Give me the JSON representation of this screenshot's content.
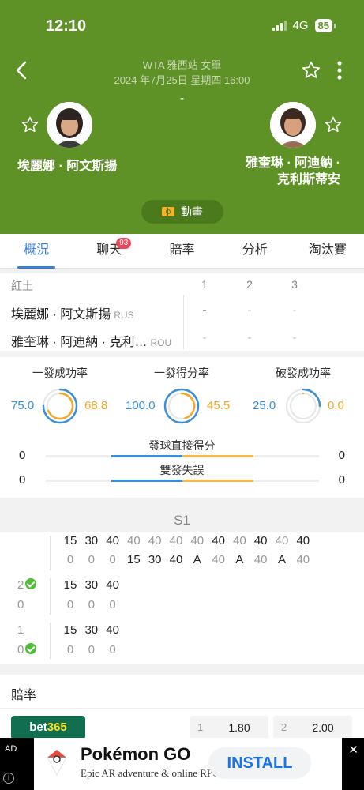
{
  "status_bar": {
    "time": "12:10",
    "network": "4G",
    "battery": "85"
  },
  "header": {
    "event_name": "WTA 雅西站 女單",
    "event_time": "2024 年7月25日 星期四 16:00",
    "score": "-",
    "animation_label": "動畫",
    "player1": {
      "name": "埃麗娜 · 阿文斯揚"
    },
    "player2": {
      "name_line1": "雅奎琳 · 阿迪納 ·",
      "name_line2": "克利斯蒂安"
    }
  },
  "tabs": [
    {
      "label": "概況",
      "active": true
    },
    {
      "label": "聊天",
      "badge": "93"
    },
    {
      "label": "賠率"
    },
    {
      "label": "分析"
    },
    {
      "label": "淘汰賽"
    }
  ],
  "scoreboard": {
    "surface": "紅土",
    "sets": [
      "1",
      "2",
      "3"
    ],
    "rows": [
      {
        "name": "埃麗娜 · 阿文斯揚",
        "country": "RUS",
        "scores": [
          "-",
          "-",
          "-"
        ]
      },
      {
        "name": "雅奎琳 · 阿迪納 · 克利…",
        "country": "ROU",
        "scores": [
          "-",
          "-",
          "-"
        ]
      }
    ]
  },
  "stats": {
    "gauges": [
      {
        "title": "一發成功率",
        "left": "75.0",
        "right": "68.8",
        "left_pct": 75.0,
        "right_pct": 68.8
      },
      {
        "title": "一發得分率",
        "left": "100.0",
        "right": "45.5",
        "left_pct": 100.0,
        "right_pct": 45.5
      },
      {
        "title": "破發成功率",
        "left": "25.0",
        "right": "0.0",
        "left_pct": 25.0,
        "right_pct": 0.0
      }
    ],
    "bars": [
      {
        "title": "發球直接得分",
        "left": "0",
        "right": "0"
      },
      {
        "title": "雙發失誤",
        "left": "0",
        "right": "0"
      }
    ]
  },
  "point_by_point": {
    "set_label": "S1",
    "game1": {
      "top": [
        "15",
        "30",
        "40",
        "40",
        "40",
        "40",
        "40",
        "40",
        "40",
        "40",
        "40",
        "40"
      ],
      "top_dark": [
        true,
        true,
        true,
        false,
        false,
        false,
        false,
        true,
        false,
        true,
        false,
        true
      ],
      "bottom": [
        "0",
        "0",
        "0",
        "15",
        "30",
        "40",
        "A",
        "40",
        "A",
        "40",
        "A",
        "40"
      ],
      "bottom_dark": [
        false,
        false,
        false,
        true,
        true,
        true,
        true,
        false,
        true,
        false,
        true,
        false
      ]
    },
    "game2": {
      "score_top": "2",
      "score_bottom": "0",
      "top": [
        "15",
        "30",
        "40"
      ],
      "bottom": [
        "0",
        "0",
        "0"
      ]
    },
    "game3": {
      "score_top": "1",
      "score_bottom": "0",
      "top": [
        "15",
        "30",
        "40"
      ],
      "bottom": [
        "0",
        "0",
        "0"
      ]
    }
  },
  "odds": {
    "title": "賠率",
    "bookmaker_a": "bet",
    "bookmaker_b": "365",
    "items": [
      {
        "index": "1",
        "value": "1.80"
      },
      {
        "index": "2",
        "value": "2.00"
      }
    ]
  },
  "ad": {
    "tag": "AD",
    "title": "Pokémon GO",
    "subtitle": "Epic AR adventure & online RPG",
    "cta": "INSTALL"
  },
  "colors": {
    "header_green": "#5e9126",
    "accent_blue": "#3a7fd4",
    "orange": "#f5a623"
  }
}
